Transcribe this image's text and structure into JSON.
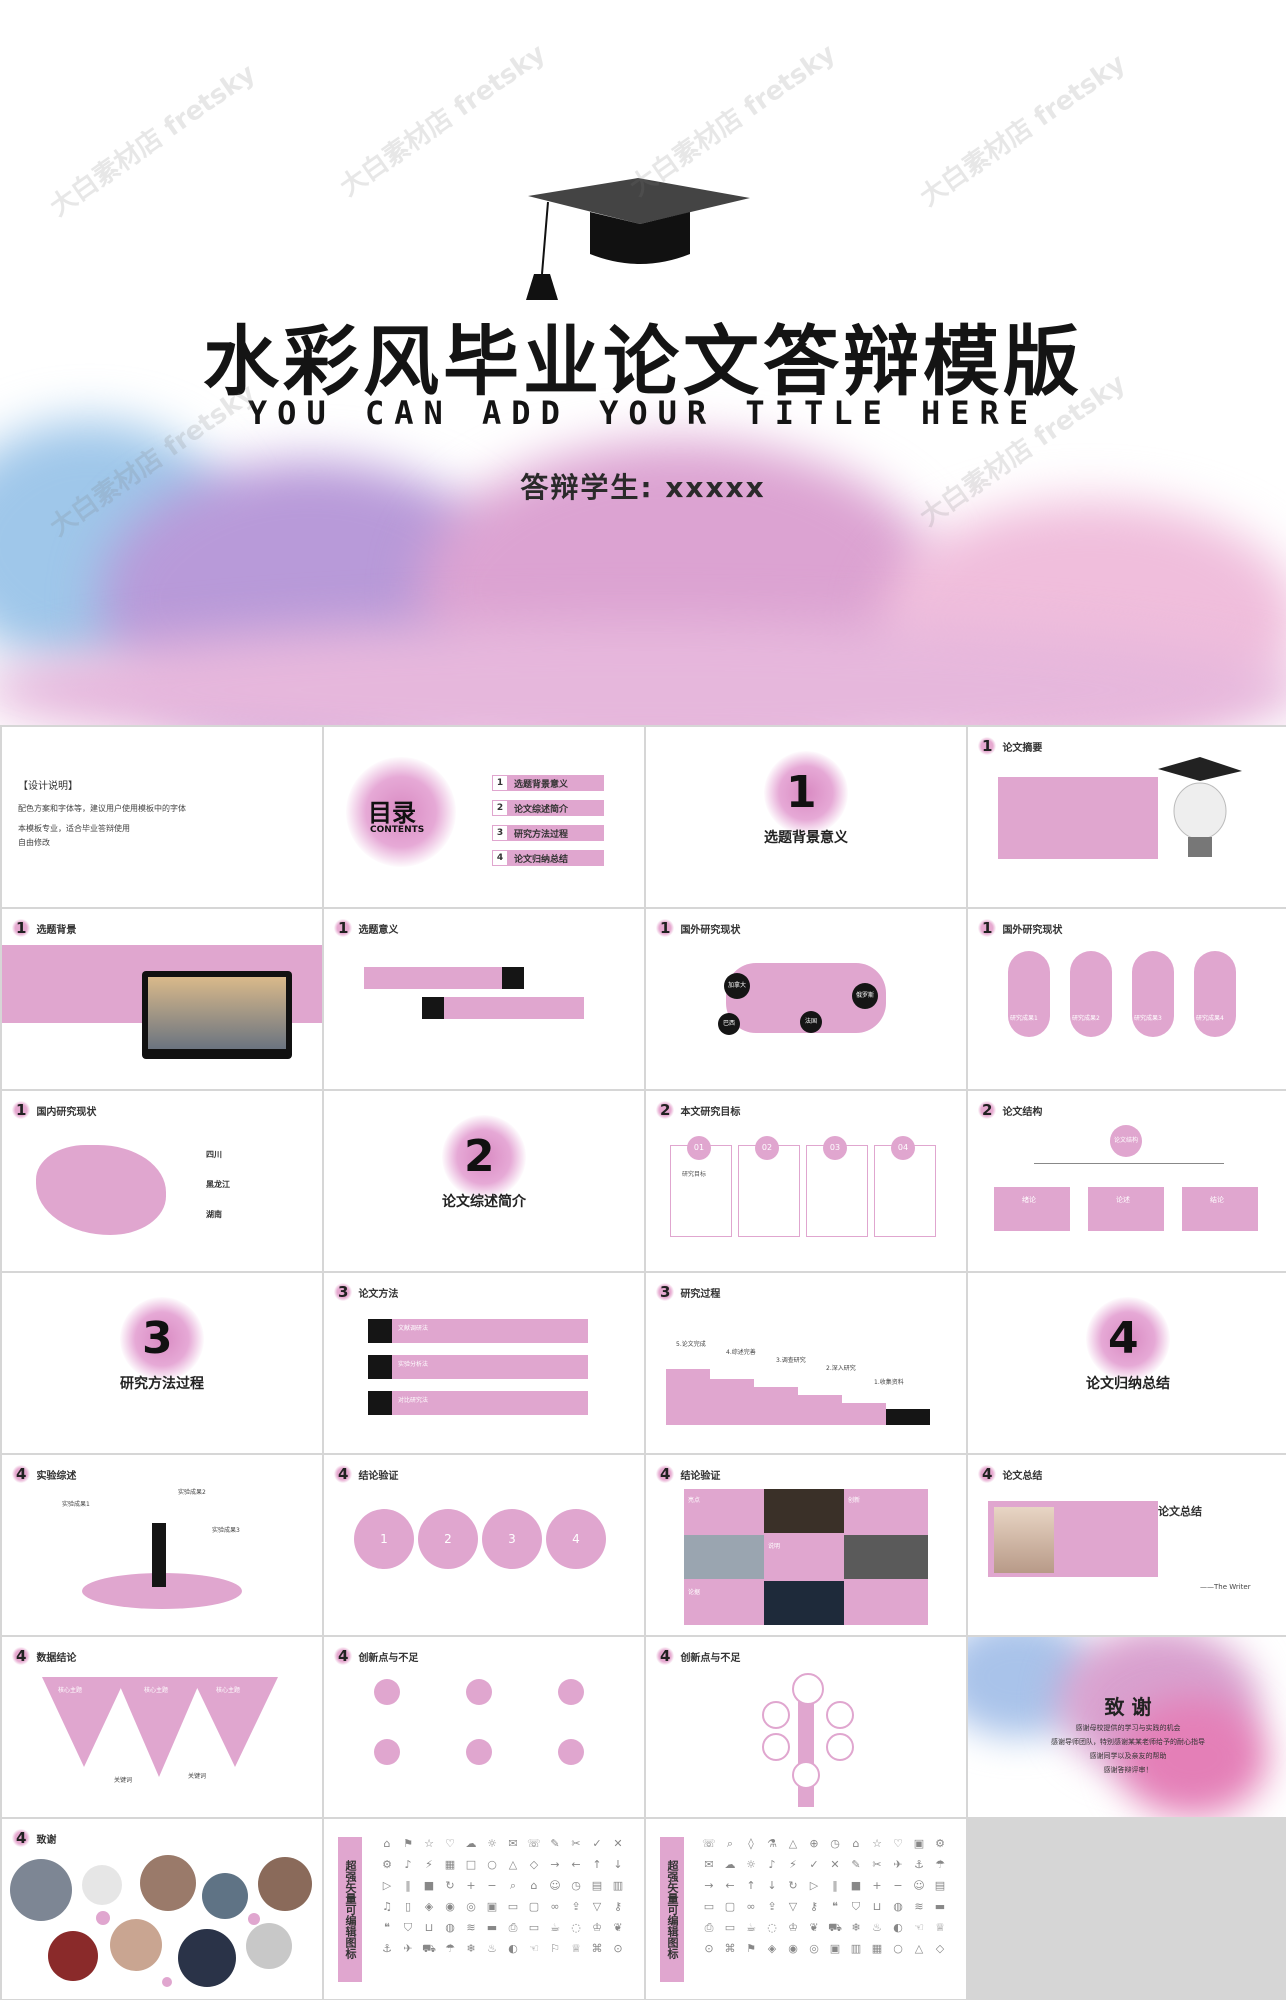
{
  "hero": {
    "title": "水彩风毕业论文答辩模版",
    "subtitle": "YOU CAN ADD YOUR TITLE HERE",
    "student": "答辩学生: xxxxx",
    "watermark_text": "大白素材店 fretsky"
  },
  "colors": {
    "accent": "#e0a6cf",
    "dark": "#151515"
  },
  "tiles": {
    "design_note": {
      "title": "【设计说明】",
      "lines": [
        "配色方案和字体等，建议用户使用模板中的字体",
        "本模板专业，适合毕业答辩使用",
        "自由修改"
      ]
    },
    "toc": {
      "title": "目录",
      "subtitle": "CONTENTS",
      "items": [
        "选题背景意义",
        "论文综述简介",
        "研究方法过程",
        "论文归纳总结"
      ],
      "nums": [
        "1",
        "2",
        "3",
        "4"
      ]
    },
    "sect1": {
      "num": "1",
      "title": "选题背景意义"
    },
    "abstract": {
      "num": "1",
      "title": "论文摘要"
    },
    "background": {
      "num": "1",
      "title": "选题背景"
    },
    "significance": {
      "num": "1",
      "title": "选题意义"
    },
    "intl1": {
      "num": "1",
      "title": "国外研究现状",
      "pins": [
        "加拿大",
        "法国",
        "俄罗斯",
        "巴西"
      ]
    },
    "intl2": {
      "num": "1",
      "title": "国外研究现状",
      "labels": [
        "研究成果1",
        "研究成果2",
        "研究成果3",
        "研究成果4"
      ]
    },
    "domestic": {
      "num": "1",
      "title": "国内研究现状",
      "places": [
        "四川",
        "黑龙江",
        "湖南"
      ]
    },
    "sect2": {
      "num": "2",
      "title": "论文综述简介"
    },
    "goals": {
      "num": "2",
      "title": "本文研究目标",
      "nums": [
        "01",
        "02",
        "03",
        "04"
      ],
      "label": "研究目标"
    },
    "structure": {
      "num": "2",
      "title": "论文结构",
      "root": "论文结构",
      "nodes": [
        "绪论",
        "论述",
        "结论"
      ]
    },
    "sect3": {
      "num": "3",
      "title": "研究方法过程"
    },
    "methods": {
      "num": "3",
      "title": "论文方法",
      "rows": [
        "文献调研法",
        "实验分析法",
        "对比研究法"
      ]
    },
    "process": {
      "num": "3",
      "title": "研究过程",
      "steps": [
        "5.论文完成",
        "4.综述完善",
        "3.调查研究",
        "2.深入研究",
        "1.收集资料"
      ]
    },
    "sect4": {
      "num": "4",
      "title": "论文归纳总结"
    },
    "experiment": {
      "num": "4",
      "title": "实验综述",
      "labels": [
        "实验成果1",
        "实验成果2",
        "实验成果3"
      ]
    },
    "verify1": {
      "num": "4",
      "title": "结论验证",
      "circles": [
        "1",
        "2",
        "3",
        "4"
      ]
    },
    "verify2": {
      "num": "4",
      "title": "结论验证",
      "labels": [
        "亮点",
        "创新",
        "说明",
        "论据"
      ]
    },
    "summary": {
      "num": "4",
      "title": "论文总结",
      "heading": "论文总结",
      "signature": "——The Writer"
    },
    "data_conclusion": {
      "num": "4",
      "title": "数据结论",
      "labels": [
        "核心主题",
        "核心主题",
        "核心主题"
      ],
      "bottom": [
        "关键词",
        "关键词"
      ]
    },
    "innovation1": {
      "num": "4",
      "title": "创新点与不足"
    },
    "innovation2": {
      "num": "4",
      "title": "创新点与不足"
    },
    "thanks_cover": {
      "title": "致 谢",
      "lines": [
        "感谢母校提供的学习与实践的机会",
        "感谢导师团队，特别感谢某某老师给予的耐心指导",
        "感谢同学以及亲友的帮助",
        "感谢答辩评审！"
      ]
    },
    "thanks": {
      "num": "4",
      "title": "致谢"
    },
    "icons_a": {
      "label": "超强矢量可编辑图标"
    },
    "icons_b": {
      "label": "超强矢量可编辑图标"
    }
  }
}
